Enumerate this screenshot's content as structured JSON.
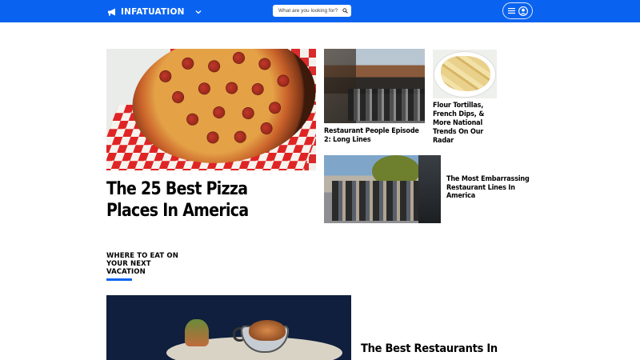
{
  "header": {
    "brand": "INFATUATION",
    "search_placeholder": "What are you looking for?",
    "icons": {
      "logo": "megaphone-icon",
      "brand_menu": "chevron-down-icon",
      "search": "search-icon",
      "menu": "hamburger-menu-icon",
      "account": "account-circle-icon"
    },
    "bar_color": "#0a63f0"
  },
  "hero": {
    "image": "pizza-photo",
    "title": "The 25 Best Pizza Places In America"
  },
  "cards": [
    {
      "image": "long-lines-photo",
      "title": "Restaurant People Episode 2: Long Lines"
    },
    {
      "image": "tortillas-photo",
      "title": "Flour Tortillas, French Dips, & More National Trends On Our Radar"
    },
    {
      "image": "restaurant-lines-photo",
      "title": "The Most Embarrassing Restaurant Lines In America"
    }
  ],
  "section": {
    "heading": "WHERE TO EAT ON YOUR NEXT VACATION",
    "accent_color": "#0a63f0"
  },
  "feature": {
    "image": "dish-photo",
    "title": "The Best Restaurants In"
  }
}
